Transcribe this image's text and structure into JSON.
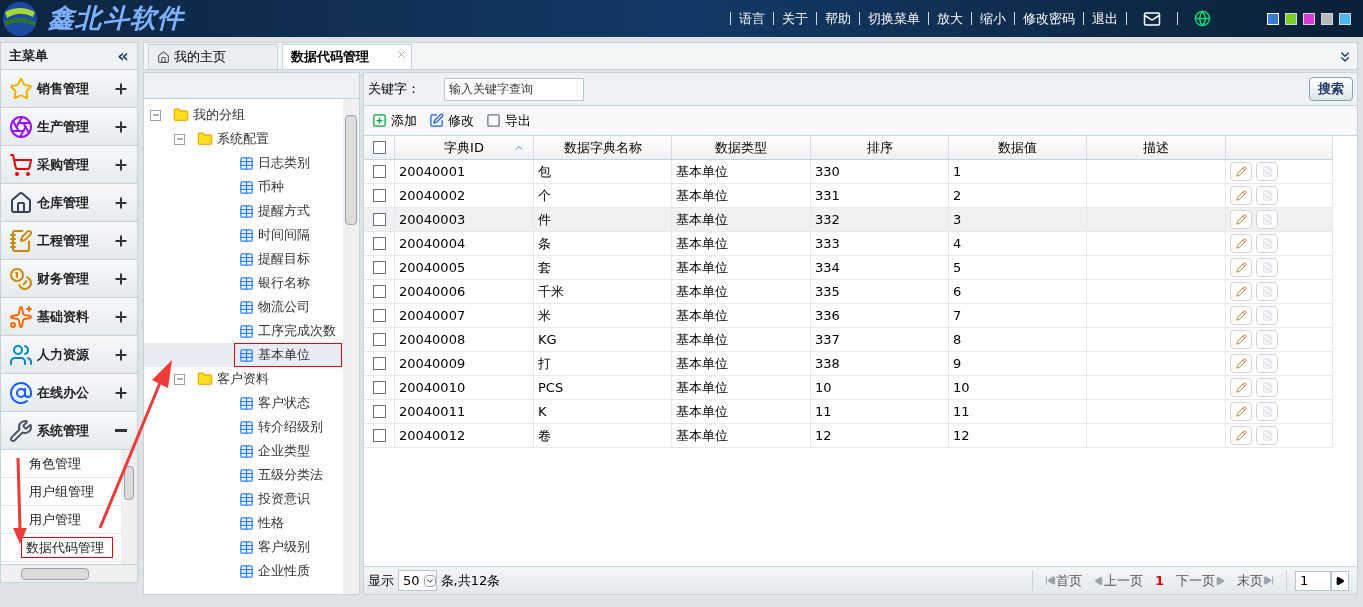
{
  "header": {
    "logo_text": "鑫北斗软件",
    "links": [
      "语言",
      "关于",
      "帮助",
      "切换菜单",
      "放大",
      "缩小",
      "修改密码",
      "退出"
    ],
    "themes": [
      {
        "color": "#3a7bd5",
        "selected": true
      },
      {
        "color": "#7ccd2a",
        "selected": false
      },
      {
        "color": "#d63ccf",
        "selected": false
      },
      {
        "color": "#b8b8b8",
        "selected": false
      },
      {
        "color": "#4cb8f0",
        "selected": false
      }
    ]
  },
  "sidebar": {
    "title": "主菜单",
    "collapse": "«",
    "items": [
      {
        "label": "销售管理",
        "expanded": false
      },
      {
        "label": "生产管理",
        "expanded": false
      },
      {
        "label": "采购管理",
        "expanded": false
      },
      {
        "label": "仓库管理",
        "expanded": false
      },
      {
        "label": "工程管理",
        "expanded": false
      },
      {
        "label": "财务管理",
        "expanded": false
      },
      {
        "label": "基础资料",
        "expanded": false
      },
      {
        "label": "人力资源",
        "expanded": false
      },
      {
        "label": "在线办公",
        "expanded": false
      },
      {
        "label": "系统管理",
        "expanded": true,
        "children": [
          {
            "label": "角色管理",
            "selected": false
          },
          {
            "label": "用户组管理",
            "selected": false
          },
          {
            "label": "用户管理",
            "selected": false
          },
          {
            "label": "数据代码管理",
            "selected": true
          }
        ]
      }
    ]
  },
  "tabs": [
    {
      "label": "我的主页",
      "selected": false,
      "closable": false
    },
    {
      "label": "数据代码管理",
      "selected": true,
      "closable": true
    }
  ],
  "tree": [
    {
      "label": "我的分组",
      "expanded": true,
      "children": [
        {
          "label": "系统配置",
          "expanded": true,
          "children": [
            {
              "label": "日志类别",
              "selected": false
            },
            {
              "label": "币种",
              "selected": false
            },
            {
              "label": "提醒方式",
              "selected": false
            },
            {
              "label": "时间间隔",
              "selected": false
            },
            {
              "label": "提醒目标",
              "selected": false
            },
            {
              "label": "银行名称",
              "selected": false
            },
            {
              "label": "物流公司",
              "selected": false
            },
            {
              "label": "工序完成次数",
              "selected": false
            },
            {
              "label": "基本单位",
              "selected": true
            }
          ]
        },
        {
          "label": "客户资料",
          "expanded": true,
          "children": [
            {
              "label": "客户状态",
              "selected": false
            },
            {
              "label": "转介绍级别",
              "selected": false
            },
            {
              "label": "企业类型",
              "selected": false
            },
            {
              "label": "五级分类法",
              "selected": false
            },
            {
              "label": "投资意识",
              "selected": false
            },
            {
              "label": "性格",
              "selected": false
            },
            {
              "label": "客户级别",
              "selected": false
            },
            {
              "label": "企业性质",
              "selected": false
            }
          ]
        }
      ]
    }
  ],
  "search": {
    "label": "关键字：",
    "placeholder": "输入关键字查询",
    "button": "搜索"
  },
  "toolbar": [
    {
      "kind": "add",
      "label": "添加"
    },
    {
      "kind": "edit",
      "label": "修改"
    },
    {
      "kind": "export",
      "label": "导出"
    }
  ],
  "table": {
    "all_checked": false,
    "columns": [
      {
        "label": "字典ID",
        "sorted": true
      },
      {
        "label": "数据字典名称",
        "sorted": false
      },
      {
        "label": "数据类型",
        "sorted": false
      },
      {
        "label": "排序",
        "sorted": false
      },
      {
        "label": "数据值",
        "sorted": false
      },
      {
        "label": "描述",
        "sorted": false
      }
    ],
    "rows": [
      {
        "cells": [
          "20040001",
          "包",
          "基本单位",
          "330",
          "1",
          ""
        ],
        "checked": false,
        "hovered": false
      },
      {
        "cells": [
          "20040002",
          "个",
          "基本单位",
          "331",
          "2",
          ""
        ],
        "checked": false,
        "hovered": false
      },
      {
        "cells": [
          "20040003",
          "件",
          "基本单位",
          "332",
          "3",
          ""
        ],
        "checked": false,
        "hovered": true
      },
      {
        "cells": [
          "20040004",
          "条",
          "基本单位",
          "333",
          "4",
          ""
        ],
        "checked": false,
        "hovered": false
      },
      {
        "cells": [
          "20040005",
          "套",
          "基本单位",
          "334",
          "5",
          ""
        ],
        "checked": false,
        "hovered": false
      },
      {
        "cells": [
          "20040006",
          "千米",
          "基本单位",
          "335",
          "6",
          ""
        ],
        "checked": false,
        "hovered": false
      },
      {
        "cells": [
          "20040007",
          "米",
          "基本单位",
          "336",
          "7",
          ""
        ],
        "checked": false,
        "hovered": false
      },
      {
        "cells": [
          "20040008",
          "KG",
          "基本单位",
          "337",
          "8",
          ""
        ],
        "checked": false,
        "hovered": false
      },
      {
        "cells": [
          "20040009",
          "打",
          "基本单位",
          "338",
          "9",
          ""
        ],
        "checked": false,
        "hovered": false
      },
      {
        "cells": [
          "20040010",
          "PCS",
          "基本单位",
          "10",
          "10",
          ""
        ],
        "checked": false,
        "hovered": false
      },
      {
        "cells": [
          "20040011",
          "K",
          "基本单位",
          "11",
          "11",
          ""
        ],
        "checked": false,
        "hovered": false
      },
      {
        "cells": [
          "20040012",
          "卷",
          "基本单位",
          "12",
          "12",
          ""
        ],
        "checked": false,
        "hovered": false
      }
    ]
  },
  "pager": {
    "show": "显示",
    "page_size": "50",
    "total": "条,共12条",
    "first": "首页",
    "prev": "上一页",
    "current": "1",
    "next": "下一页",
    "last": "末页",
    "goto": "1"
  }
}
